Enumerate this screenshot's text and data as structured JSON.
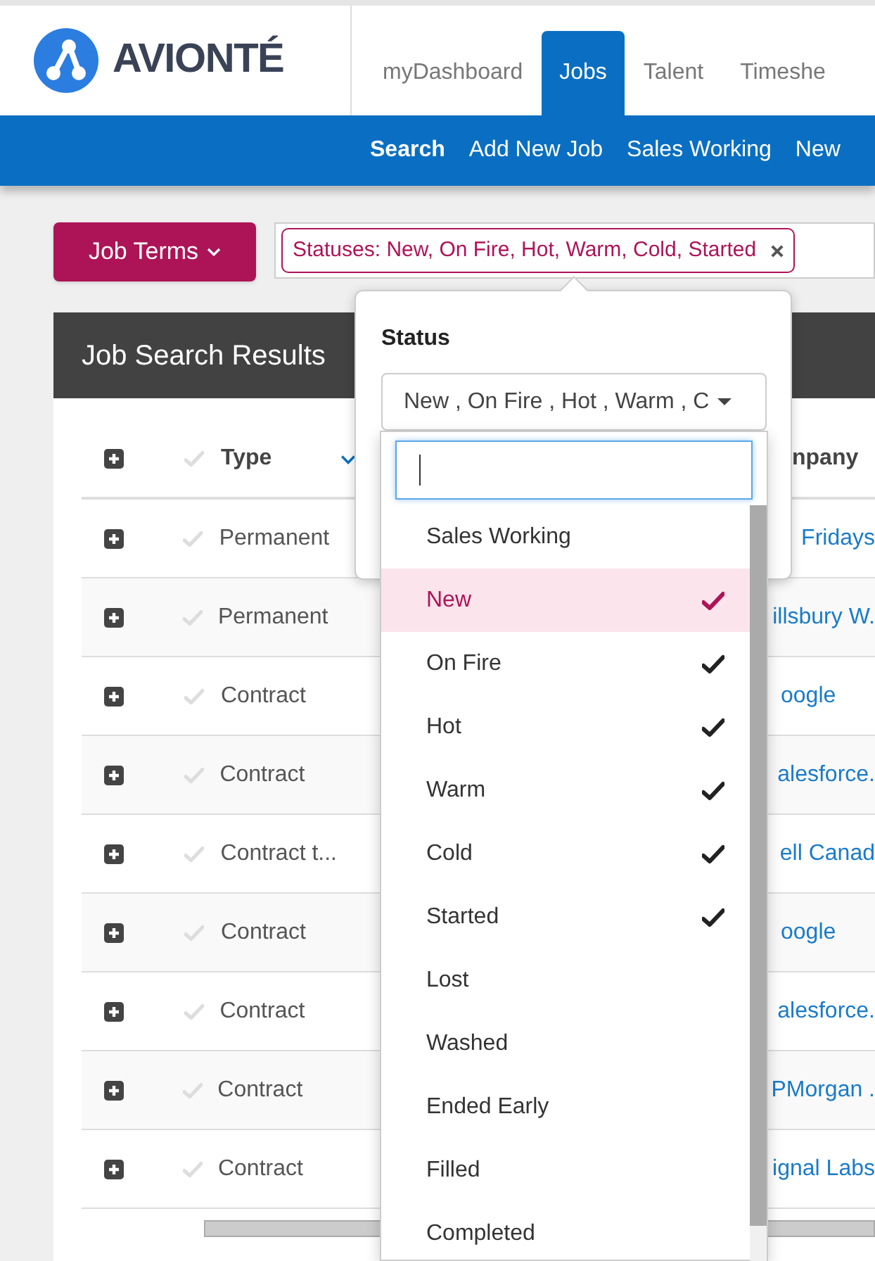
{
  "header": {
    "logo_text": "AVIONTÉ",
    "tabs": [
      {
        "label": "myDashboard",
        "selected": false
      },
      {
        "label": "Jobs",
        "selected": true
      },
      {
        "label": "Talent",
        "selected": false
      },
      {
        "label": "Timeshe",
        "selected": false
      }
    ],
    "subnav": [
      {
        "label": "Search",
        "selected": true
      },
      {
        "label": "Add New Job",
        "selected": false
      },
      {
        "label": "Sales Working",
        "selected": false
      },
      {
        "label": "New",
        "selected": false
      }
    ]
  },
  "filters": {
    "button": "Job Terms",
    "tags": [
      {
        "label": "Statuses: New, On Fire, Hot, Warm, Cold, Started"
      }
    ]
  },
  "results": {
    "title": "Job Search Results",
    "columns": [
      "Type",
      "npany"
    ],
    "rows": [
      {
        "type": "Permanent",
        "company": "Fridays"
      },
      {
        "type": "Permanent",
        "company": "illsbury W."
      },
      {
        "type": "Contract",
        "company": "oogle"
      },
      {
        "type": "Contract",
        "company": "alesforce."
      },
      {
        "type": "Contract t...",
        "company": "ell Canad"
      },
      {
        "type": "Contract",
        "company": "oogle"
      },
      {
        "type": "Contract",
        "company": "alesforce."
      },
      {
        "type": "Contract",
        "company": "PMorgan ."
      },
      {
        "type": "Contract",
        "company": "ignal Labs"
      }
    ]
  },
  "status_popover": {
    "label": "Status",
    "select_value": "New , On Fire , Hot , Warm , C",
    "options": [
      {
        "label": "Sales Working",
        "checked": false,
        "selected": false
      },
      {
        "label": "New",
        "checked": true,
        "selected": true
      },
      {
        "label": "On Fire",
        "checked": true,
        "selected": false
      },
      {
        "label": "Hot",
        "checked": true,
        "selected": false
      },
      {
        "label": "Warm",
        "checked": true,
        "selected": false
      },
      {
        "label": "Cold",
        "checked": true,
        "selected": false
      },
      {
        "label": "Started",
        "checked": true,
        "selected": false
      },
      {
        "label": "Lost",
        "checked": false,
        "selected": false
      },
      {
        "label": "Washed",
        "checked": false,
        "selected": false
      },
      {
        "label": "Ended Early",
        "checked": false,
        "selected": false
      },
      {
        "label": "Filled",
        "checked": false,
        "selected": false
      },
      {
        "label": "Completed",
        "checked": false,
        "selected": false
      }
    ]
  }
}
